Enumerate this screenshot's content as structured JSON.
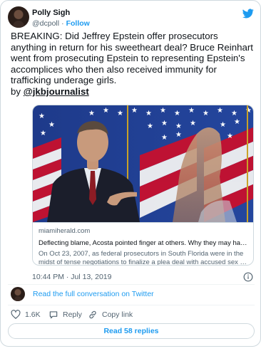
{
  "author": {
    "name": "Polly Sigh",
    "handle": "@dcpoll",
    "separator": "·",
    "follow_label": "Follow"
  },
  "tweet": {
    "text": "BREAKING: Did Jeffrey Epstein offer prosecutors anything in return for his sweetheart deal? Bruce Reinhart went from prosecuting Epstein to representing Epstein's accomplices who then also received immunity for trafficking underage girls.",
    "by_prefix": "by ",
    "mention": "@jkbjournalist"
  },
  "link_card": {
    "domain": "miamiherald.com",
    "title": "Deflecting blame, Acosta pointed finger at others. Why they may hav…",
    "description": "On Oct 23, 2007, as federal prosecutors in South Florida were in the midst of tense negotiations to finalize a plea deal with accused sex …"
  },
  "timestamp": "10:44 PM · Jul 13, 2019",
  "conversation_link": "Read the full conversation on Twitter",
  "actions": {
    "like_count": "1.6K",
    "reply_label": "Reply",
    "copy_label": "Copy link"
  },
  "read_replies_label": "Read 58 replies",
  "icons": {
    "brand": "twitter-bird-icon",
    "info": "info-icon",
    "like": "heart-icon",
    "reply": "speech-bubble-icon",
    "copy": "link-chain-icon"
  },
  "colors": {
    "accent": "#1d9bf0",
    "text": "#0f1419",
    "muted": "#536471",
    "border": "#cfd9de"
  }
}
